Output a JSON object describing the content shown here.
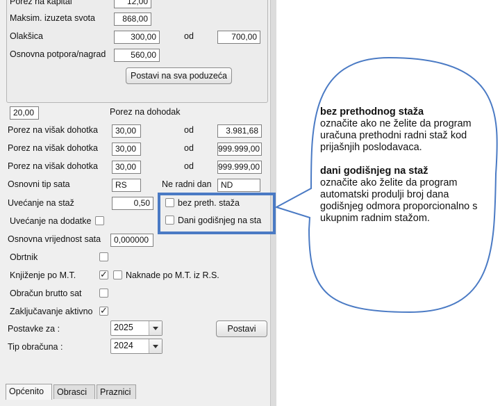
{
  "top_group": {
    "porez_kapital_label": "Porez na kapital",
    "porez_kapital_value": "12,00",
    "maks_label": "Maksim. izuzeta svota",
    "maks_value": "868,00",
    "olaksica_label": "Olakšica",
    "olaksica_value": "300,00",
    "olaksica_od_label": "od",
    "olaksica_od_value": "700,00",
    "potpora_label": "Osnovna potpora/nagrad",
    "potpora_value": "560,00",
    "apply_all_label": "Postavi na sva poduzeća"
  },
  "dohodak": {
    "rate": "20,00",
    "label": "Porez na dohodak"
  },
  "visak_rows": [
    {
      "label": "Porez na višak dohotka",
      "rate": "30,00",
      "od": "od",
      "limit": "3.981,68"
    },
    {
      "label": "Porez na višak dohotka",
      "rate": "30,00",
      "od": "od",
      "limit": "999.999,00"
    },
    {
      "label": "Porez na višak dohotka",
      "rate": "30,00",
      "od": "od",
      "limit": "999.999,00"
    }
  ],
  "sati": {
    "osnovni_label": "Osnovni tip sata",
    "osnovni_value": "RS",
    "neradni_label": "Ne radni dan",
    "neradni_value": "ND"
  },
  "uvecanje_staz": {
    "label": "Uvećanje na staž",
    "value": "0,50"
  },
  "checks": {
    "bez_preth_label": "bez preth. staža",
    "dani_god_label": "Dani godišnjeg na sta",
    "uvecanje_dodatke_label": "Uvećanje na dodatke",
    "osnovna_vrijednost_label": "Osnovna vrijednost sata",
    "osnovna_vrijednost_value": "0,000000",
    "obrtnik_label": "Obrtnik",
    "knjizenje_label": "Knjiženje po M.T.",
    "naknade_label": "Naknade po M.T. iz R.S.",
    "obracun_label": "Obračun brutto sat",
    "zakljucavanje_label": "Zaključavanje aktivno"
  },
  "postavke": {
    "label": "Postavke za :",
    "value": "2025",
    "button": "Postavi"
  },
  "tip_obracuna": {
    "label": "Tip obračuna :",
    "value": "2024"
  },
  "tabs": [
    "Općenito",
    "Obrasci",
    "Praznici"
  ],
  "callout": {
    "title1": "bez prethodnog staža",
    "text1": "označite ako ne želite da program uračuna prethodni radni staž kod prijašnjih poslodavaca.",
    "title2": "dani godišnjeg na staž",
    "text2": "označite ako želite da program automatski produlji broj dana godišnjeg odmora proporcionalno s ukupnim radnim stažom."
  },
  "colors": {
    "highlight": "#4a7ac4",
    "callout_border": "#4a7ac4"
  }
}
